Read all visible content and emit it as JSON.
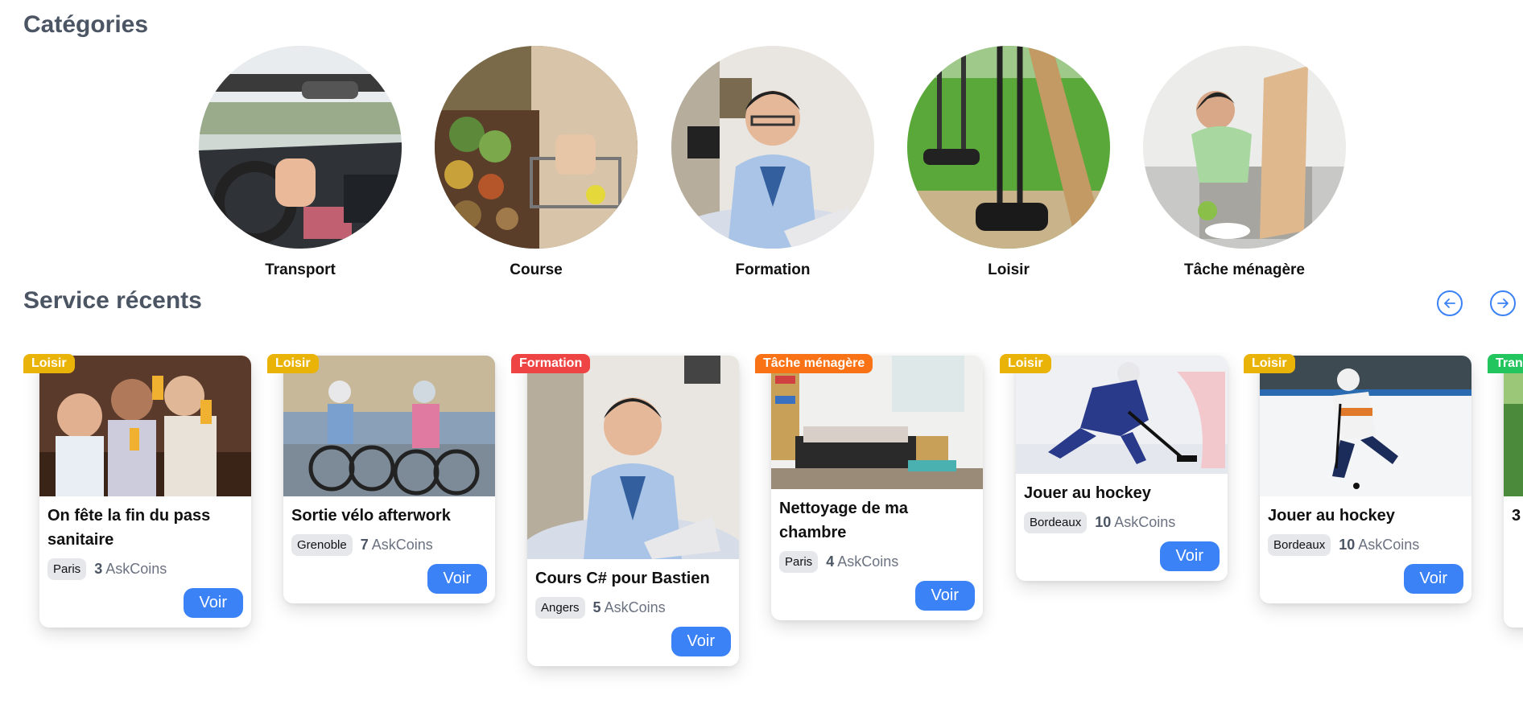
{
  "categories_section": {
    "title": "Catégories",
    "items": [
      {
        "label": "Transport"
      },
      {
        "label": "Course"
      },
      {
        "label": "Formation"
      },
      {
        "label": "Loisir"
      },
      {
        "label": "Tâche ménagère"
      }
    ]
  },
  "services_section": {
    "title": "Service récents",
    "prev_icon": "arrow-left-circle-icon",
    "next_icon": "arrow-right-circle-icon",
    "cards": [
      {
        "badge": "Loisir",
        "badge_color": "#eab308",
        "title": "On fête la fin du pass sanitaire",
        "city": "Paris",
        "coins": "3",
        "coins_label": "AskCoins",
        "button": "Voir"
      },
      {
        "badge": "Loisir",
        "badge_color": "#eab308",
        "title": "Sortie vélo afterwork",
        "city": "Grenoble",
        "coins": "7",
        "coins_label": "AskCoins",
        "button": "Voir"
      },
      {
        "badge": "Formation",
        "badge_color": "#ef4444",
        "title": "Cours C# pour Bastien",
        "city": "Angers",
        "coins": "5",
        "coins_label": "AskCoins",
        "button": "Voir"
      },
      {
        "badge": "Tâche ménagère",
        "badge_color": "#f97316",
        "title": "Nettoyage de ma chambre",
        "city": "Paris",
        "coins": "4",
        "coins_label": "AskCoins",
        "button": "Voir"
      },
      {
        "badge": "Loisir",
        "badge_color": "#eab308",
        "title": "Jouer au hockey",
        "city": "Bordeaux",
        "coins": "10",
        "coins_label": "AskCoins",
        "button": "Voir"
      },
      {
        "badge": "Loisir",
        "badge_color": "#eab308",
        "title": "Jouer au hockey",
        "city": "Bordeaux",
        "coins": "10",
        "coins_label": "AskCoins",
        "button": "Voir"
      },
      {
        "badge": "Tran",
        "badge_color": "#22c55e",
        "title": "3",
        "city": "",
        "coins": "",
        "coins_label": "",
        "button": ""
      }
    ]
  },
  "colors": {
    "accent": "#3b82f6",
    "heading": "#4b5563"
  }
}
